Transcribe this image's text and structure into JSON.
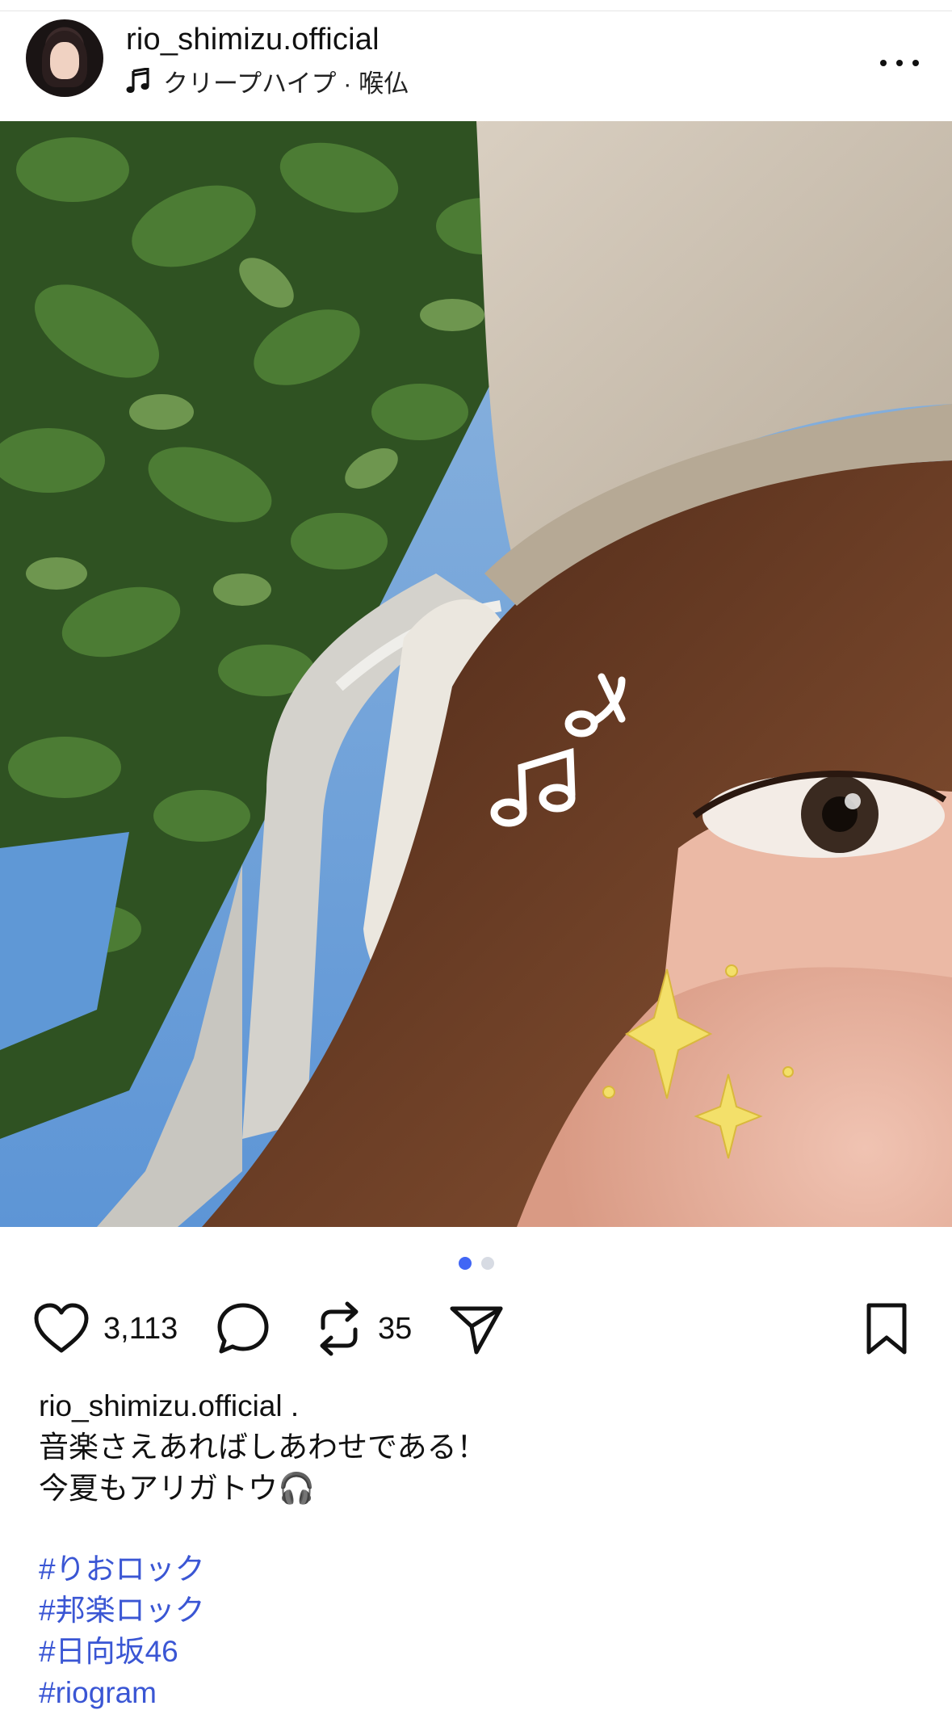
{
  "post": {
    "username": "rio_shimizu.official",
    "music": {
      "icon": "music-note-icon",
      "text": "クリープハイプ · 喉仏"
    },
    "more_icon": "more-horizontal-icon"
  },
  "media": {
    "description_icons": [
      "music-notes-doodle-icon",
      "sparkles-doodle-icon"
    ],
    "mute_icon": "speaker-muted-icon",
    "carousel": {
      "count": 2,
      "active_index": 0
    },
    "colors": {
      "sky": "#6a9fd6",
      "leaf": "#3f6b2c",
      "hair": "#6b3a24",
      "cap": "#cbbfae",
      "skin": "#e9b7a4",
      "sparkle": "#f3e06a"
    }
  },
  "actions": {
    "like": {
      "icon": "heart-icon",
      "count": "3,113"
    },
    "comment": {
      "icon": "comment-bubble-icon"
    },
    "repost": {
      "icon": "repost-icon",
      "count": "35"
    },
    "share": {
      "icon": "send-icon"
    },
    "save": {
      "icon": "bookmark-icon"
    }
  },
  "caption": {
    "username": "rio_shimizu.official",
    "separator": ".",
    "line1": "音楽さえあればしあわせである！",
    "line2": "今夏もアリガトウ🎧",
    "hashtags": [
      "#りおロック",
      "#邦楽ロック",
      "#日向坂46",
      "#riogram"
    ]
  },
  "theme": {
    "accent": "#4166f5",
    "hashtag": "#3a56d4",
    "text": "#111111"
  }
}
